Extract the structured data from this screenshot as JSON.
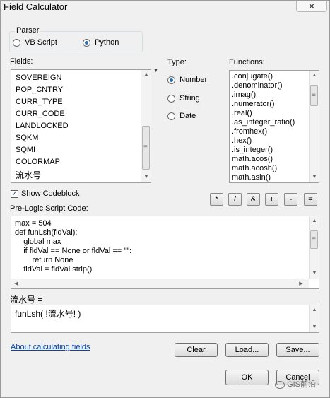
{
  "window": {
    "title": "Field Calculator",
    "close_glyph": "✕"
  },
  "parser": {
    "label": "Parser",
    "options": [
      "VB Script",
      "Python"
    ],
    "selected": "Python"
  },
  "fields": {
    "label": "Fields:",
    "items": [
      "SOVEREIGN",
      "POP_CNTRY",
      "CURR_TYPE",
      "CURR_CODE",
      "LANDLOCKED",
      "SQKM",
      "SQMI",
      "COLORMAP",
      "流水号"
    ]
  },
  "type": {
    "label": "Type:",
    "options": [
      "Number",
      "String",
      "Date"
    ],
    "selected": "Number"
  },
  "functions": {
    "label": "Functions:",
    "items": [
      ".conjugate()",
      ".denominator()",
      ".imag()",
      ".numerator()",
      ".real()",
      ".as_integer_ratio()",
      ".fromhex()",
      ".hex()",
      ".is_integer()",
      "math.acos()",
      "math.acosh()",
      "math.asin()"
    ]
  },
  "codeblock": {
    "checkbox_label": "Show Codeblock",
    "checked": true,
    "label": "Pre-Logic Script Code:",
    "lines": [
      "max = 504",
      "def funLsh(fldVal):",
      "    global max",
      "    if fldVal == None or fldVal == \"\":",
      "        return None",
      "    fldVal = fldVal.strip()"
    ]
  },
  "operators": [
    "*",
    "/",
    "&",
    "+",
    "-",
    "="
  ],
  "expression": {
    "label": "流水号 =",
    "value": "funLsh( !流水号! )"
  },
  "links": {
    "about": "About calculating fields"
  },
  "buttons": {
    "clear": "Clear",
    "load": "Load...",
    "save": "Save...",
    "ok": "OK",
    "cancel": "Cancel"
  },
  "watermark": {
    "text": "GIS前沿"
  }
}
